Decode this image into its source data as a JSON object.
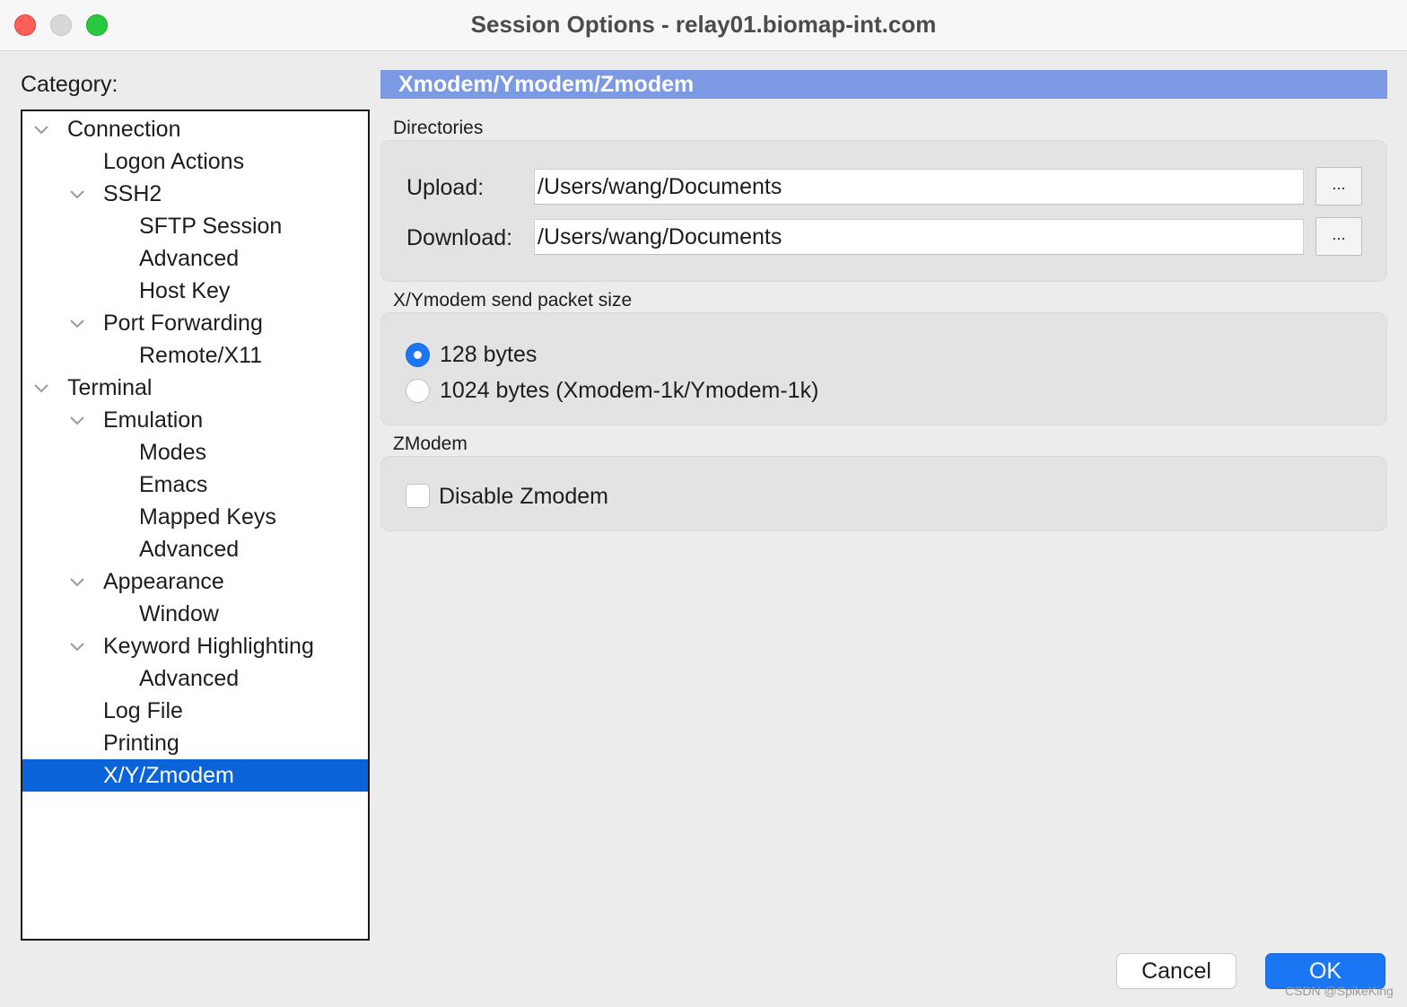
{
  "window": {
    "title": "Session Options - relay01.biomap-int.com"
  },
  "category": {
    "label": "Category:",
    "items": [
      {
        "label": "Connection",
        "level": 0,
        "expanded": true,
        "chevron": true
      },
      {
        "label": "Logon Actions",
        "level": 1,
        "chevron": false
      },
      {
        "label": "SSH2",
        "level": 1,
        "expanded": true,
        "chevron": true
      },
      {
        "label": "SFTP Session",
        "level": 2,
        "chevron": false
      },
      {
        "label": "Advanced",
        "level": 2,
        "chevron": false
      },
      {
        "label": "Host Key",
        "level": 2,
        "chevron": false
      },
      {
        "label": "Port Forwarding",
        "level": 1,
        "expanded": true,
        "chevron": true
      },
      {
        "label": "Remote/X11",
        "level": 2,
        "chevron": false
      },
      {
        "label": "Terminal",
        "level": 0,
        "expanded": true,
        "chevron": true
      },
      {
        "label": "Emulation",
        "level": 1,
        "expanded": true,
        "chevron": true
      },
      {
        "label": "Modes",
        "level": 2,
        "chevron": false
      },
      {
        "label": "Emacs",
        "level": 2,
        "chevron": false
      },
      {
        "label": "Mapped Keys",
        "level": 2,
        "chevron": false
      },
      {
        "label": "Advanced",
        "level": 2,
        "chevron": false
      },
      {
        "label": "Appearance",
        "level": 1,
        "expanded": true,
        "chevron": true
      },
      {
        "label": "Window",
        "level": 2,
        "chevron": false
      },
      {
        "label": "Keyword Highlighting",
        "level": 1,
        "expanded": true,
        "chevron": true
      },
      {
        "label": "Advanced",
        "level": 2,
        "chevron": false
      },
      {
        "label": "Log File",
        "level": 1,
        "chevron": false
      },
      {
        "label": "Printing",
        "level": 1,
        "chevron": false
      },
      {
        "label": "X/Y/Zmodem",
        "level": 1,
        "chevron": false,
        "selected": true
      }
    ]
  },
  "panel": {
    "header": "Xmodem/Ymodem/Zmodem",
    "directories": {
      "label": "Directories",
      "upload_label": "Upload:",
      "upload_value": "/Users/wang/Documents",
      "download_label": "Download:",
      "download_value": "/Users/wang/Documents",
      "browse_label": "..."
    },
    "packet_size": {
      "label": "X/Ymodem send packet size",
      "options": [
        {
          "label": "128 bytes",
          "checked": true
        },
        {
          "label": "1024 bytes (Xmodem-1k/Ymodem-1k)",
          "checked": false
        }
      ]
    },
    "zmodem": {
      "label": "ZModem",
      "disable_label": "Disable Zmodem",
      "disable_checked": false
    }
  },
  "buttons": {
    "cancel": "Cancel",
    "ok": "OK"
  },
  "watermark": "CSDN @SpikeKing",
  "colors": {
    "accent": "#1a76f2",
    "selection": "#0a63d8",
    "section_header": "#7b9ae3",
    "close": "#fe5f57",
    "maximize": "#28c840"
  }
}
